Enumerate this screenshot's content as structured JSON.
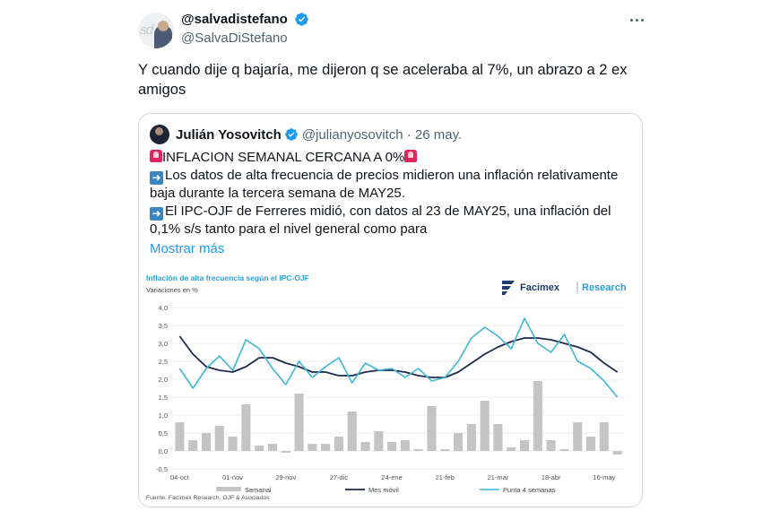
{
  "tweet": {
    "author_name": "@salvadistefano",
    "handle": "@SalvaDiStefano",
    "avatar_initials": "sd",
    "text": "Y cuando dije q bajaría, me dijeron q se aceleraba al 7%, un abrazo a 2 ex amigos"
  },
  "quote": {
    "author_name": "Julián Yosovitch",
    "handle_date": "@julianyosovitch · 26 may.",
    "line1": "INFLACION SEMANAL CERCANA A 0%",
    "line2": "Los datos de alta frecuencia de precios midieron una inflación relativamente baja durante la tercera semana de MAY25.",
    "line3": "El IPC-OJF de Ferreres midió, con datos al 23 de MAY25, una inflación del 0,1% s/s tanto para el nivel general como para",
    "show_more": "Mostrar más"
  },
  "chart_data": {
    "type": "bar",
    "title": "Inflación de alta frecuencia según el IPC-OJF",
    "ylabel": "Variaciones en %",
    "brand": "Facimex",
    "brand_suffix": "Research",
    "source": "Fuente: Facimex Research, OJF & Asociados",
    "ylim": [
      -0.5,
      4.0
    ],
    "yticks": [
      "4,0",
      "3,5",
      "3,0",
      "2,5",
      "2,0",
      "1,5",
      "1,0",
      "0,5",
      "0,0",
      "-0,5"
    ],
    "xtick_labels": [
      "04-oct",
      "01-nov",
      "29-nov",
      "27-dic",
      "24-ene",
      "21-feb",
      "21-mar",
      "18-abr",
      "16-may"
    ],
    "xtick_index": [
      0,
      4,
      8,
      12,
      16,
      20,
      24,
      28,
      32
    ],
    "n_weeks": 34,
    "colors": {
      "semanal": "#c4c4c4",
      "mes_movil": "#1f2a4d",
      "punta4": "#3fb6d8",
      "title": "#2b9fd6"
    },
    "series": [
      {
        "name": "Semanal",
        "kind": "bar",
        "values": [
          0.8,
          0.3,
          0.5,
          0.7,
          0.4,
          1.3,
          0.15,
          0.2,
          -0.05,
          1.6,
          0.2,
          0.2,
          0.4,
          1.1,
          0.25,
          0.55,
          0.25,
          0.3,
          0.05,
          1.25,
          0.05,
          0.5,
          0.75,
          1.4,
          0.75,
          0.1,
          0.3,
          1.95,
          0.3,
          0.05,
          0.8,
          0.4,
          0.8,
          -0.1
        ]
      },
      {
        "name": "Mes móvil",
        "kind": "line",
        "values": [
          3.2,
          2.7,
          2.35,
          2.25,
          2.2,
          2.35,
          2.6,
          2.6,
          2.45,
          2.35,
          2.2,
          2.2,
          2.1,
          2.1,
          2.2,
          2.25,
          2.25,
          2.2,
          2.1,
          2.05,
          2.05,
          2.2,
          2.45,
          2.7,
          2.9,
          3.05,
          3.15,
          3.15,
          3.1,
          3.0,
          2.9,
          2.75,
          2.45,
          2.2
        ]
      },
      {
        "name": "Punta 4 semanas",
        "kind": "line",
        "values": [
          2.3,
          1.75,
          2.3,
          2.65,
          2.25,
          3.1,
          2.85,
          2.3,
          1.85,
          2.5,
          2.05,
          2.35,
          2.6,
          1.9,
          2.45,
          2.25,
          2.3,
          2.05,
          2.3,
          1.95,
          2.05,
          2.5,
          3.15,
          3.45,
          3.2,
          2.85,
          3.7,
          3.0,
          2.75,
          3.25,
          2.5,
          2.3,
          1.95,
          1.5
        ]
      }
    ]
  }
}
